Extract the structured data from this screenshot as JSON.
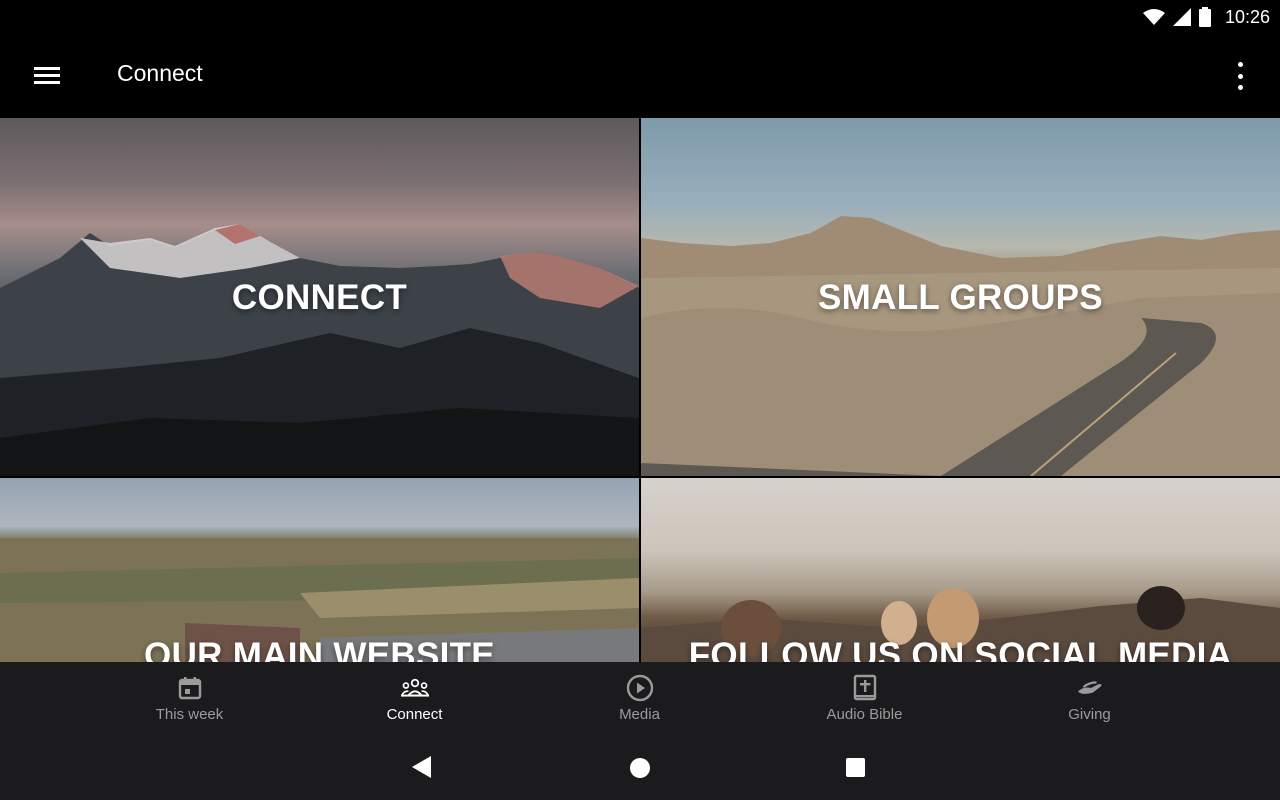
{
  "status_bar": {
    "time": "10:26",
    "icons": [
      "wifi-icon",
      "cell-signal-icon",
      "battery-icon"
    ]
  },
  "app_bar": {
    "title": "Connect",
    "icons": [
      "hamburger-menu-icon",
      "more-vert-icon"
    ]
  },
  "tiles": [
    {
      "label": "CONNECT"
    },
    {
      "label": "SMALL GROUPS"
    },
    {
      "label": "OUR MAIN WEBSITE"
    },
    {
      "label": "FOLLOW US ON SOCIAL MEDIA"
    }
  ],
  "bottom_nav": {
    "active_index": 1,
    "items": [
      {
        "label": "This week",
        "icon": "calendar-icon"
      },
      {
        "label": "Connect",
        "icon": "people-group-icon"
      },
      {
        "label": "Media",
        "icon": "play-circle-icon"
      },
      {
        "label": "Audio Bible",
        "icon": "bible-icon"
      },
      {
        "label": "Giving",
        "icon": "giving-hand-icon"
      }
    ]
  },
  "system_nav": {
    "icons": [
      "back-icon",
      "home-icon",
      "recents-icon"
    ]
  },
  "colors": {
    "app_bar_bg": "#000000",
    "bottom_nav_bg": "#1b1b1d",
    "nav_inactive": "#9b9b9b",
    "nav_active": "#ffffff"
  }
}
